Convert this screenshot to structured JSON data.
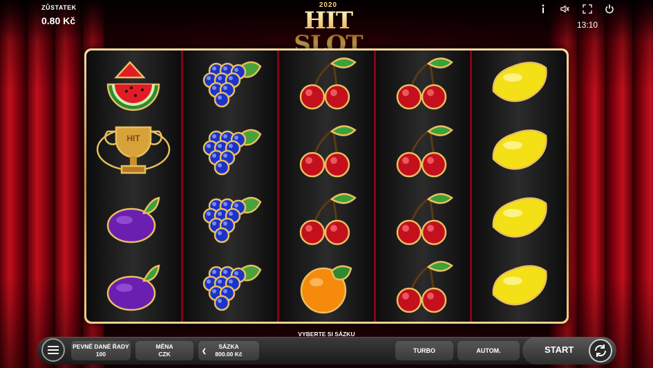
{
  "header": {
    "balance_label": "ZŮSTATEK",
    "balance_value": "0.80 Kč",
    "logo_year": "2020",
    "logo_name": "HIT SLOT",
    "time": "13:10",
    "icons": [
      "info-icon",
      "sound-icon",
      "fullscreen-icon",
      "power-icon"
    ]
  },
  "reels": [
    [
      "watermelon",
      "trophy",
      "plum",
      "plum"
    ],
    [
      "grapes",
      "grapes",
      "grapes",
      "grapes"
    ],
    [
      "cherries",
      "cherries",
      "cherries",
      "orange"
    ],
    [
      "cherries",
      "cherries",
      "cherries",
      "cherries"
    ],
    [
      "lemon",
      "lemon",
      "lemon",
      "lemon"
    ]
  ],
  "controls": {
    "prompt": "VYBERTE SI SÁZKU",
    "lines_label": "PEVNĚ DANÉ ŘADY",
    "lines_value": "100",
    "currency_label": "MĚNA",
    "currency_value": "CZK",
    "bet_label": "SÁZKA",
    "bet_value": "800.00 Kč",
    "turbo_label": "TURBO",
    "auto_label": "AUTOM.",
    "start_label": "START"
  },
  "colors": {
    "curtain": "#c0101c",
    "gold": "#e7b75a",
    "reel_divider": "#8a0010"
  }
}
